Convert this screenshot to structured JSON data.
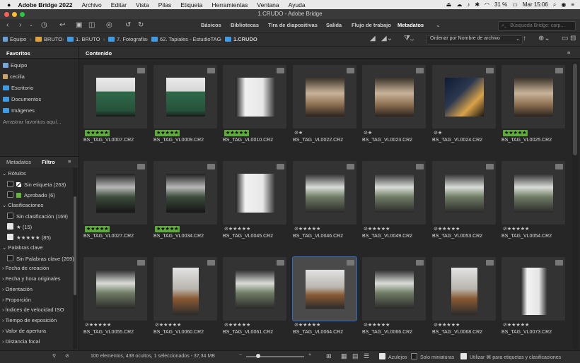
{
  "menubar": {
    "app_name": "Adobe Bridge 2022",
    "items": [
      "Archivo",
      "Editar",
      "Vista",
      "Pilas",
      "Etiqueta",
      "Herramientas",
      "Ventana",
      "Ayuda"
    ],
    "battery": "31 %",
    "clock": "Mar 15:06"
  },
  "window": {
    "title": "1.CRUDO - Adobe Bridge"
  },
  "toolbar": {
    "workspaces": [
      "Básicos",
      "Bibliotecas",
      "Tira de diapositivas",
      "Salida",
      "Flujo de trabajo",
      "Metadatos"
    ],
    "active_workspace": "Metadatos",
    "search_placeholder": "Búsqueda Bridge: carp..."
  },
  "pathbar": {
    "crumbs": [
      "Equipo",
      "BRUTO",
      "1. BRUTO",
      "7. Fotografía",
      "62. Tapiales - EstudioTAG",
      "1.CRUDO"
    ],
    "sort_label": "Ordenar por Nombre de archivo"
  },
  "favorites": {
    "tab_label": "Favoritos",
    "items": [
      "Equipo",
      "cecilia",
      "Escritorio",
      "Documentos",
      "Imágenes"
    ],
    "drop_hint": "Arrastrar favoritos aquí..."
  },
  "filter_panel": {
    "tabs": [
      "Metadatos",
      "Filtro"
    ],
    "active_tab": "Filtro",
    "sections": {
      "rotulos": "Rótulos",
      "sin_etiqueta": "Sin etiqueta",
      "sin_etiqueta_count": "(263)",
      "aprobado": "Aprobado",
      "aprobado_count": "(6)",
      "clasificaciones": "Clasificaciones",
      "sin_clasificacion": "Sin clasificación",
      "sin_clasificacion_count": "(169)",
      "one_star": "★",
      "one_star_count": "(15)",
      "five_star": "★★★★★",
      "five_star_count": "(85)",
      "palabras_clave": "Palabras clave",
      "sin_palabras": "Sin Palabras clave",
      "sin_palabras_count": "(269)",
      "collapsed": [
        "Fecha de creación",
        "Fecha y hora originales",
        "Orientación",
        "Proporción",
        "Índices de velocidad ISO",
        "Tiempo de exposición",
        "Valor de apertura",
        "Distancia focal"
      ]
    }
  },
  "content": {
    "tab_label": "Contenido",
    "thumbnails": [
      {
        "name": "BS_TAG_VL0007.CR2",
        "rating": "★★★★★",
        "label": "approved",
        "orient": "landscape",
        "tone": "green"
      },
      {
        "name": "BS_TAG_VL0009.CR2",
        "rating": "★★★★★",
        "label": "approved",
        "orient": "landscape",
        "tone": "green"
      },
      {
        "name": "BS_TAG_VL0010.CR2",
        "rating": "★★★★★",
        "label": "approved",
        "orient": "landscape",
        "tone": "white"
      },
      {
        "name": "BS_TAG_VL0022.CR2",
        "rating": "⊘★",
        "label": "none",
        "orient": "landscape",
        "tone": "warm"
      },
      {
        "name": "BS_TAG_VL0023.CR2",
        "rating": "⊘★",
        "label": "none",
        "orient": "landscape",
        "tone": "warm"
      },
      {
        "name": "BS_TAG_VL0024.CR2",
        "rating": "⊘★",
        "label": "none",
        "orient": "landscape",
        "tone": "night"
      },
      {
        "name": "BS_TAG_VL0025.CR2",
        "rating": "★★★★★",
        "label": "approved",
        "orient": "landscape",
        "tone": "warm"
      },
      {
        "name": "BS_TAG_VL0027.CR2",
        "rating": "★★★★★",
        "label": "approved",
        "orient": "landscape",
        "tone": "dark"
      },
      {
        "name": "BS_TAG_VL0034.CR2",
        "rating": "★★★★★",
        "label": "approved",
        "orient": "landscape",
        "tone": "dark"
      },
      {
        "name": "BS_TAG_VL0045.CR2",
        "rating": "⊘★★★★★",
        "label": "none",
        "orient": "landscape",
        "tone": "white"
      },
      {
        "name": "BS_TAG_VL0046.CR2",
        "rating": "⊘★★★★★",
        "label": "none",
        "orient": "landscape",
        "tone": "grey"
      },
      {
        "name": "BS_TAG_VL0049.CR2",
        "rating": "⊘★★★★★",
        "label": "none",
        "orient": "landscape",
        "tone": "grey"
      },
      {
        "name": "BS_TAG_VL0053.CR2",
        "rating": "⊘★★★★★",
        "label": "none",
        "orient": "landscape",
        "tone": "grey"
      },
      {
        "name": "BS_TAG_VL0054.CR2",
        "rating": "⊘★★★★★",
        "label": "none",
        "orient": "landscape",
        "tone": "grey"
      },
      {
        "name": "BS_TAG_VL0055.CR2",
        "rating": "⊘★★★★★",
        "label": "none",
        "orient": "landscape",
        "tone": "grey"
      },
      {
        "name": "BS_TAG_VL0060.CR2",
        "rating": "⊘★★★★★",
        "label": "none",
        "orient": "portrait",
        "tone": "wood"
      },
      {
        "name": "BS_TAG_VL0061.CR2",
        "rating": "⊘★★★★★",
        "label": "none",
        "orient": "landscape",
        "tone": "grey"
      },
      {
        "name": "BS_TAG_VL0064.CR2",
        "rating": "⊘★★★★★",
        "label": "none",
        "orient": "landscape",
        "tone": "wood",
        "selected": true
      },
      {
        "name": "BS_TAG_VL0066.CR2",
        "rating": "⊘★★★★★",
        "label": "none",
        "orient": "landscape",
        "tone": "grey"
      },
      {
        "name": "BS_TAG_VL0068.CR2",
        "rating": "⊘★★★★★",
        "label": "none",
        "orient": "portrait",
        "tone": "wood"
      },
      {
        "name": "BS_TAG_VL0073.CR2",
        "rating": "⊘★★★★★",
        "label": "none",
        "orient": "portrait",
        "tone": "white"
      }
    ]
  },
  "statusbar": {
    "summary": "100 elementos, 438 ocultos, 1 seleccionados - 37,34 MB",
    "azulejos": "Azulejos",
    "solo_miniaturas": "Solo miniaturas",
    "utilizar": "Utilizar ⌘ para etiquetas y clasificaciones"
  }
}
